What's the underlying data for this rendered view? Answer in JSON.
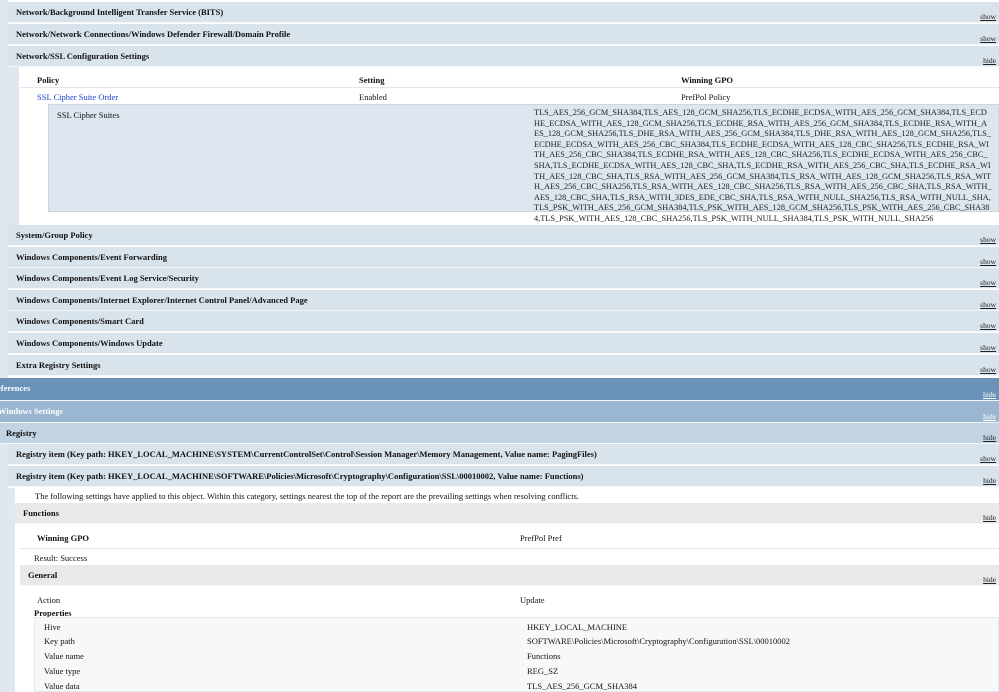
{
  "toggle": {
    "show": "show",
    "hide": "hide"
  },
  "sections_top": [
    {
      "title": "Network/Background Intelligent Transfer Service (BITS)",
      "toggle": "show"
    },
    {
      "title": "Network/Network Connections/Windows Defender Firewall/Domain Profile",
      "toggle": "show"
    },
    {
      "title": "Network/SSL Configuration Settings",
      "toggle": "hide"
    }
  ],
  "ssl_table": {
    "headers": {
      "policy": "Policy",
      "setting": "Setting",
      "winning_gpo": "Winning GPO"
    },
    "row": {
      "policy": "SSL Cipher Suite Order",
      "setting": "Enabled",
      "winning_gpo": "PrefPol Policy"
    },
    "detail_label": "SSL Cipher Suites",
    "detail_value": "TLS_AES_256_GCM_SHA384,TLS_AES_128_GCM_SHA256,TLS_ECDHE_ECDSA_WITH_AES_256_GCM_SHA384,TLS_ECDHE_ECDSA_WITH_AES_128_GCM_SHA256,TLS_ECDHE_RSA_WITH_AES_256_GCM_SHA384,TLS_ECDHE_RSA_WITH_AES_128_GCM_SHA256,TLS_DHE_RSA_WITH_AES_256_GCM_SHA384,TLS_DHE_RSA_WITH_AES_128_GCM_SHA256,TLS_ECDHE_ECDSA_WITH_AES_256_CBC_SHA384,TLS_ECDHE_ECDSA_WITH_AES_128_CBC_SHA256,TLS_ECDHE_RSA_WITH_AES_256_CBC_SHA384,TLS_ECDHE_RSA_WITH_AES_128_CBC_SHA256,TLS_ECDHE_ECDSA_WITH_AES_256_CBC_SHA,TLS_ECDHE_ECDSA_WITH_AES_128_CBC_SHA,TLS_ECDHE_RSA_WITH_AES_256_CBC_SHA,TLS_ECDHE_RSA_WITH_AES_128_CBC_SHA,TLS_RSA_WITH_AES_256_GCM_SHA384,TLS_RSA_WITH_AES_128_GCM_SHA256,TLS_RSA_WITH_AES_256_CBC_SHA256,TLS_RSA_WITH_AES_128_CBC_SHA256,TLS_RSA_WITH_AES_256_CBC_SHA,TLS_RSA_WITH_AES_128_CBC_SHA,TLS_RSA_WITH_3DES_EDE_CBC_SHA,TLS_RSA_WITH_NULL_SHA256,TLS_RSA_WITH_NULL_SHA,TLS_PSK_WITH_AES_256_GCM_SHA384,TLS_PSK_WITH_AES_128_GCM_SHA256,TLS_PSK_WITH_AES_256_CBC_SHA384,TLS_PSK_WITH_AES_128_CBC_SHA256,TLS_PSK_WITH_NULL_SHA384,TLS_PSK_WITH_NULL_SHA256"
  },
  "sections_mid": [
    {
      "title": "System/Group Policy",
      "toggle": "show"
    },
    {
      "title": "Windows Components/Event Forwarding",
      "toggle": "show"
    },
    {
      "title": "Windows Components/Event Log Service/Security",
      "toggle": "show"
    },
    {
      "title": "Windows Components/Internet Explorer/Internet Control Panel/Advanced Page",
      "toggle": "show"
    },
    {
      "title": "Windows Components/Smart Card",
      "toggle": "show"
    },
    {
      "title": "Windows Components/Windows Update",
      "toggle": "show"
    },
    {
      "title": "Extra Registry Settings",
      "toggle": "show"
    }
  ],
  "preferences": {
    "title": "eferences",
    "toggle": "hide"
  },
  "windows_settings": {
    "title": "Windows Settings",
    "toggle": "hide"
  },
  "registry": {
    "title": "Registry",
    "toggle": "hide"
  },
  "registry_items": [
    {
      "title": "Registry item (Key path: HKEY_LOCAL_MACHINE\\SYSTEM\\CurrentControlSet\\Control\\Session Manager\\Memory Management, Value name: PagingFiles)",
      "toggle": "show"
    },
    {
      "title": "Registry item (Key path: HKEY_LOCAL_MACHINE\\SOFTWARE\\Policies\\Microsoft\\Cryptography\\Configuration\\SSL\\00010002, Value name: Functions)",
      "toggle": "hide"
    }
  ],
  "note": "The following settings have applied to this object. Within this category, settings nearest the top of the report are the prevailing settings when resolving conflicts.",
  "functions": {
    "title": "Functions",
    "toggle": "hide",
    "winning_gpo_label": "Winning GPO",
    "winning_gpo_value": "PrefPol Pref",
    "result": "Result: Success"
  },
  "general": {
    "title": "General",
    "toggle": "hide",
    "action_label": "Action",
    "action_value": "Update",
    "properties_label": "Properties",
    "properties": [
      {
        "label": "Hive",
        "value": "HKEY_LOCAL_MACHINE"
      },
      {
        "label": "Key path",
        "value": "SOFTWARE\\Policies\\Microsoft\\Cryptography\\Configuration\\SSL\\00010002"
      },
      {
        "label": "Value name",
        "value": "Functions"
      },
      {
        "label": "Value type",
        "value": "REG_SZ"
      },
      {
        "label": "Value data",
        "value": "TLS_AES_256_GCM_SHA384"
      }
    ]
  },
  "colors": {
    "section_bg": "#d9e3ec",
    "preferences_bg": "#6b93b9",
    "windows_settings_bg": "#9bb6d0",
    "registry_bg": "#c2d3e2",
    "link": "#1a3ec9"
  }
}
